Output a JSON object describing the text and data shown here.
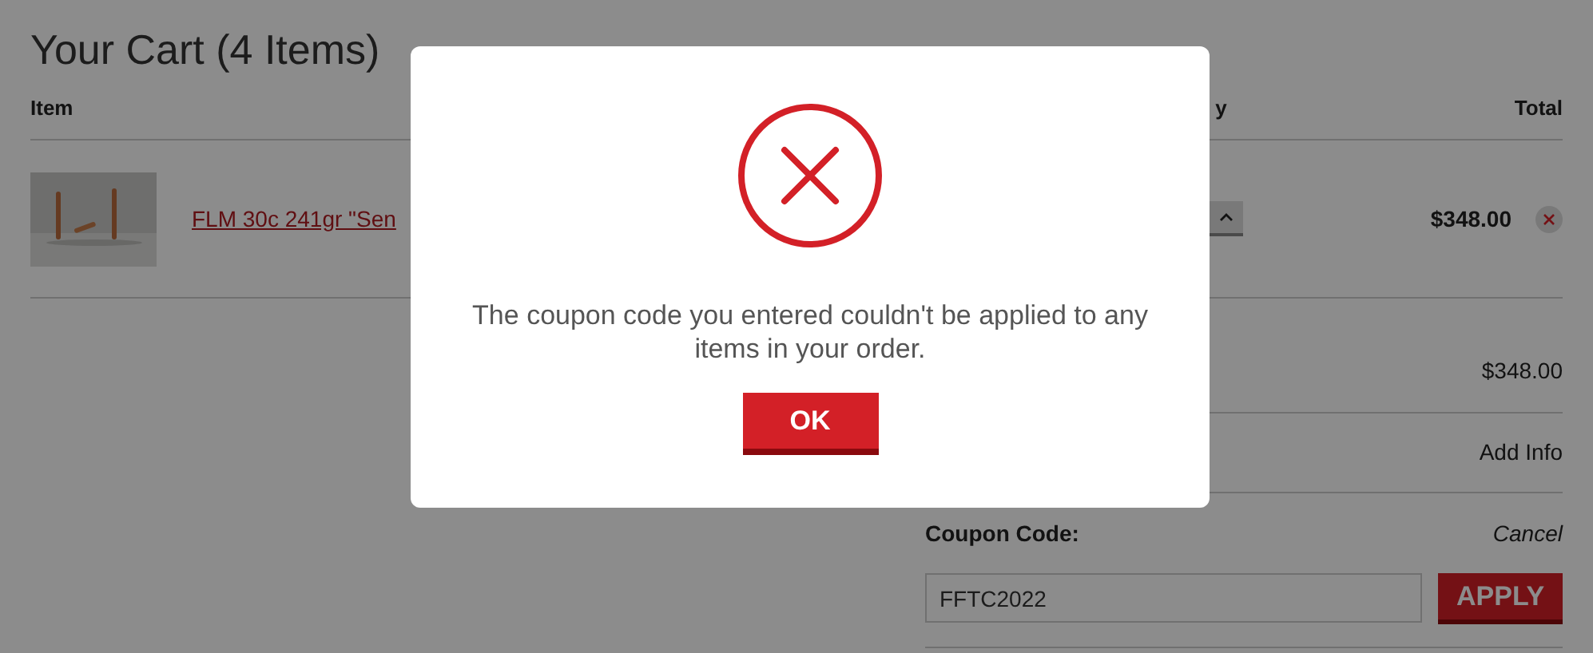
{
  "page": {
    "title": "Your Cart (4 Items)"
  },
  "cart_table": {
    "columns": [
      "Item",
      "y",
      "Total"
    ],
    "rows": [
      {
        "product": "FLM 30c 241gr \"Sen",
        "total": "$348.00"
      }
    ]
  },
  "summary": {
    "subtotal": "$348.00",
    "add_info_link": "Add Info",
    "coupon": {
      "label": "Coupon Code:",
      "cancel_link": "Cancel",
      "value": "FFTC2022",
      "apply_button": "APPLY"
    }
  },
  "modal": {
    "message": "The coupon code you entered couldn't be applied to any items in your order.",
    "button": "OK"
  }
}
